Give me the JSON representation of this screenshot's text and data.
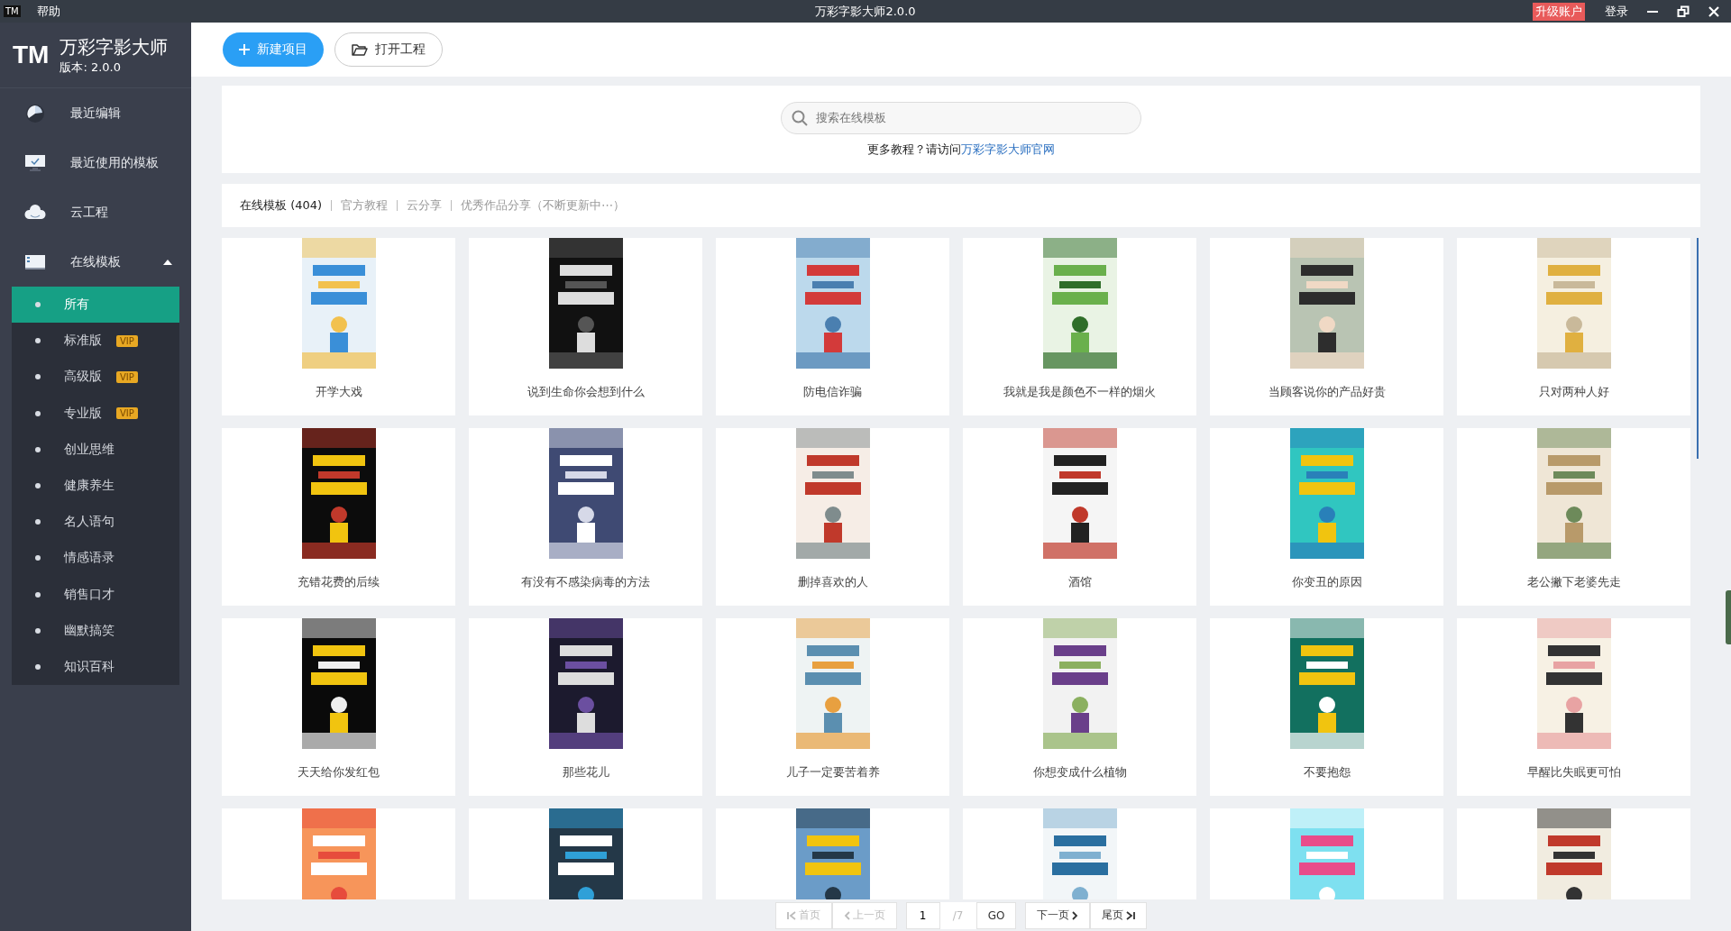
{
  "title_bar": {
    "logo": "TM",
    "menu": [
      "帮助"
    ],
    "title": "万彩字影大师2.0.0",
    "upgrade": "升级账户",
    "login": "登录"
  },
  "brand": {
    "logo": "TM",
    "name": "万彩字影大师",
    "version": "版本: 2.0.0"
  },
  "sidebar": {
    "items": [
      {
        "kind": "pie",
        "label": "最近编辑"
      },
      {
        "kind": "monitor",
        "label": "最近使用的模板"
      },
      {
        "kind": "cloud",
        "label": "云工程"
      },
      {
        "kind": "panel",
        "label": "在线模板",
        "expanded": true,
        "children": [
          {
            "label": "所有",
            "selected": true
          },
          {
            "label": "标准版",
            "selected": false,
            "badge": "VIP"
          },
          {
            "label": "高级版",
            "selected": false,
            "badge": "VIP"
          },
          {
            "label": "专业版",
            "selected": false,
            "badge": "VIP"
          },
          {
            "label": "创业思维",
            "selected": false
          },
          {
            "label": "健康养生",
            "selected": false
          },
          {
            "label": "名人语句",
            "selected": false
          },
          {
            "label": "情感语录",
            "selected": false
          },
          {
            "label": "销售口才",
            "selected": false
          },
          {
            "label": "幽默搞笑",
            "selected": false
          },
          {
            "label": "知识百科",
            "selected": false
          }
        ]
      }
    ]
  },
  "toolbar": {
    "buttons": [
      {
        "kind": "primary",
        "label": "新建项目"
      },
      {
        "kind": "folder",
        "label": "打开工程"
      }
    ]
  },
  "search": {
    "placeholder": "搜索在线模板",
    "hint": "更多教程？请访问",
    "link": "万彩字影大师官网"
  },
  "tabs": [
    {
      "label": "在线模板 (404)",
      "selected": true
    },
    {
      "label": "官方教程",
      "selected": false
    },
    {
      "label": "云分享",
      "selected": false
    },
    {
      "label": "优秀作品分享（不断更新中⋯）",
      "selected": false
    }
  ],
  "templates": [
    {
      "kind": "picture",
      "title": "开学大戏"
    },
    {
      "kind": "picture",
      "title": "说到生命你会想到什么"
    },
    {
      "kind": "picture",
      "title": "防电信诈骗"
    },
    {
      "kind": "picture",
      "title": "我就是我是颜色不一样的烟火"
    },
    {
      "kind": "picture",
      "title": "当顾客说你的产品好贵"
    },
    {
      "kind": "picture",
      "title": "只对两种人好"
    },
    {
      "kind": "picture",
      "title": "充错花费的后续"
    },
    {
      "kind": "picture",
      "title": "有没有不感染病毒的方法"
    },
    {
      "kind": "picture",
      "title": "删掉喜欢的人"
    },
    {
      "kind": "picture",
      "title": "酒馆"
    },
    {
      "kind": "picture",
      "title": "你变丑的原因"
    },
    {
      "kind": "picture",
      "title": "老公撇下老婆先走"
    },
    {
      "kind": "picture",
      "title": "天天给你发红包"
    },
    {
      "kind": "picture",
      "title": "那些花儿"
    },
    {
      "kind": "picture",
      "title": "儿子一定要苦着养"
    },
    {
      "kind": "picture",
      "title": "你想变成什么植物"
    },
    {
      "kind": "picture",
      "title": "不要抱怨"
    },
    {
      "kind": "picture",
      "title": "早醒比失眠更可怕"
    },
    {
      "kind": "picture"
    },
    {
      "kind": "picture"
    },
    {
      "kind": "picture"
    },
    {
      "kind": "picture"
    },
    {
      "kind": "picture"
    },
    {
      "kind": "picture"
    }
  ],
  "pagination": {
    "first": {
      "label": "首页",
      "disabled": true
    },
    "prev": {
      "label": "上一页",
      "disabled": true
    },
    "page": "1",
    "total": "/7",
    "go": "GO",
    "next": {
      "label": "下一页",
      "disabled": false
    },
    "last": {
      "label": "尾页",
      "disabled": false
    }
  }
}
